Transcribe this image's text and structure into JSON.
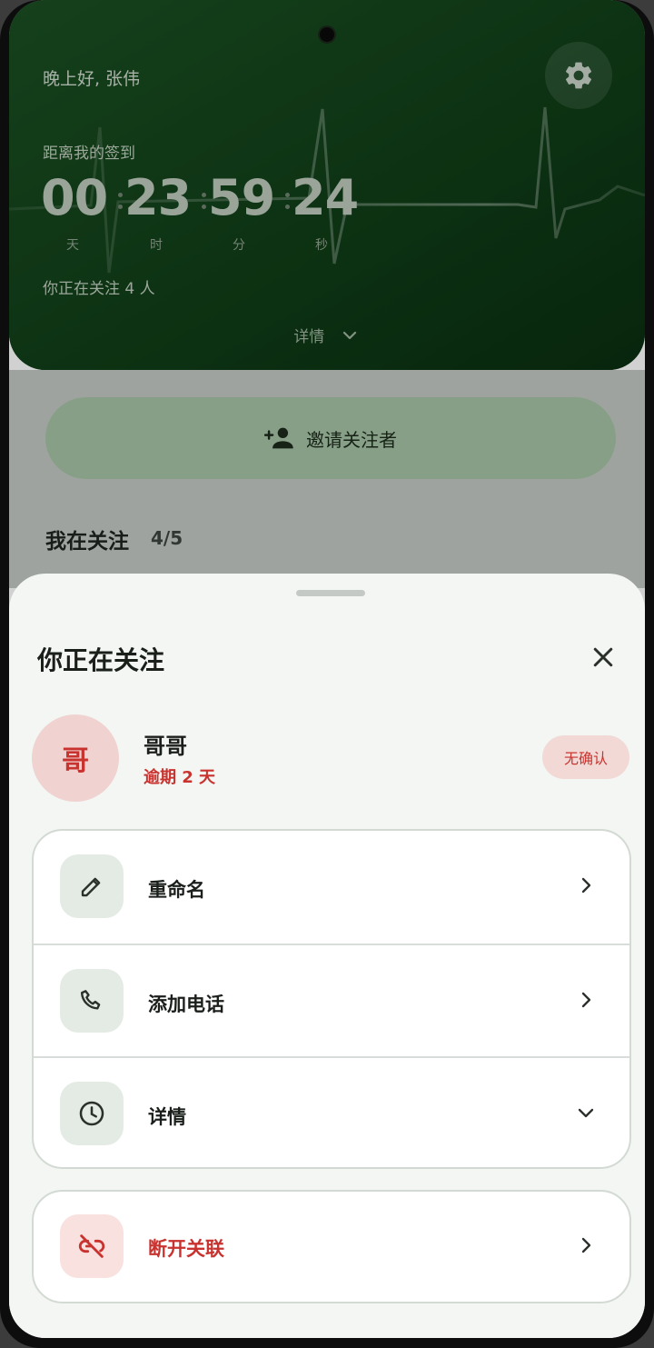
{
  "header": {
    "greeting": "晚上好, 张伟",
    "countdown_label": "距离我的签到",
    "countdown": [
      {
        "value": "00",
        "unit": "天"
      },
      {
        "value": "23",
        "unit": "时"
      },
      {
        "value": "59",
        "unit": "分"
      },
      {
        "value": "24",
        "unit": "秒"
      }
    ],
    "following_text": "你正在关注 4 人",
    "details_label": "详情",
    "accent_color": "#0c3614"
  },
  "invite": {
    "label": "邀请关注者",
    "icon": "person-add-icon"
  },
  "following_section": {
    "title": "我在关注",
    "count": "4/5"
  },
  "sheet": {
    "title": "你正在关注",
    "contact": {
      "avatar_char": "哥",
      "name": "哥哥",
      "status": "逾期 2 天",
      "badge": "无确认",
      "status_color": "#c9332f"
    },
    "actions": [
      {
        "label": "重命名",
        "icon": "pencil-icon",
        "indicator": "chevron-right-icon"
      },
      {
        "label": "添加电话",
        "icon": "phone-icon",
        "indicator": "chevron-right-icon"
      },
      {
        "label": "详情",
        "icon": "clock-icon",
        "indicator": "chevron-down-icon"
      }
    ],
    "danger_action": {
      "label": "断开关联",
      "icon": "link-off-icon",
      "indicator": "chevron-right-icon"
    }
  }
}
